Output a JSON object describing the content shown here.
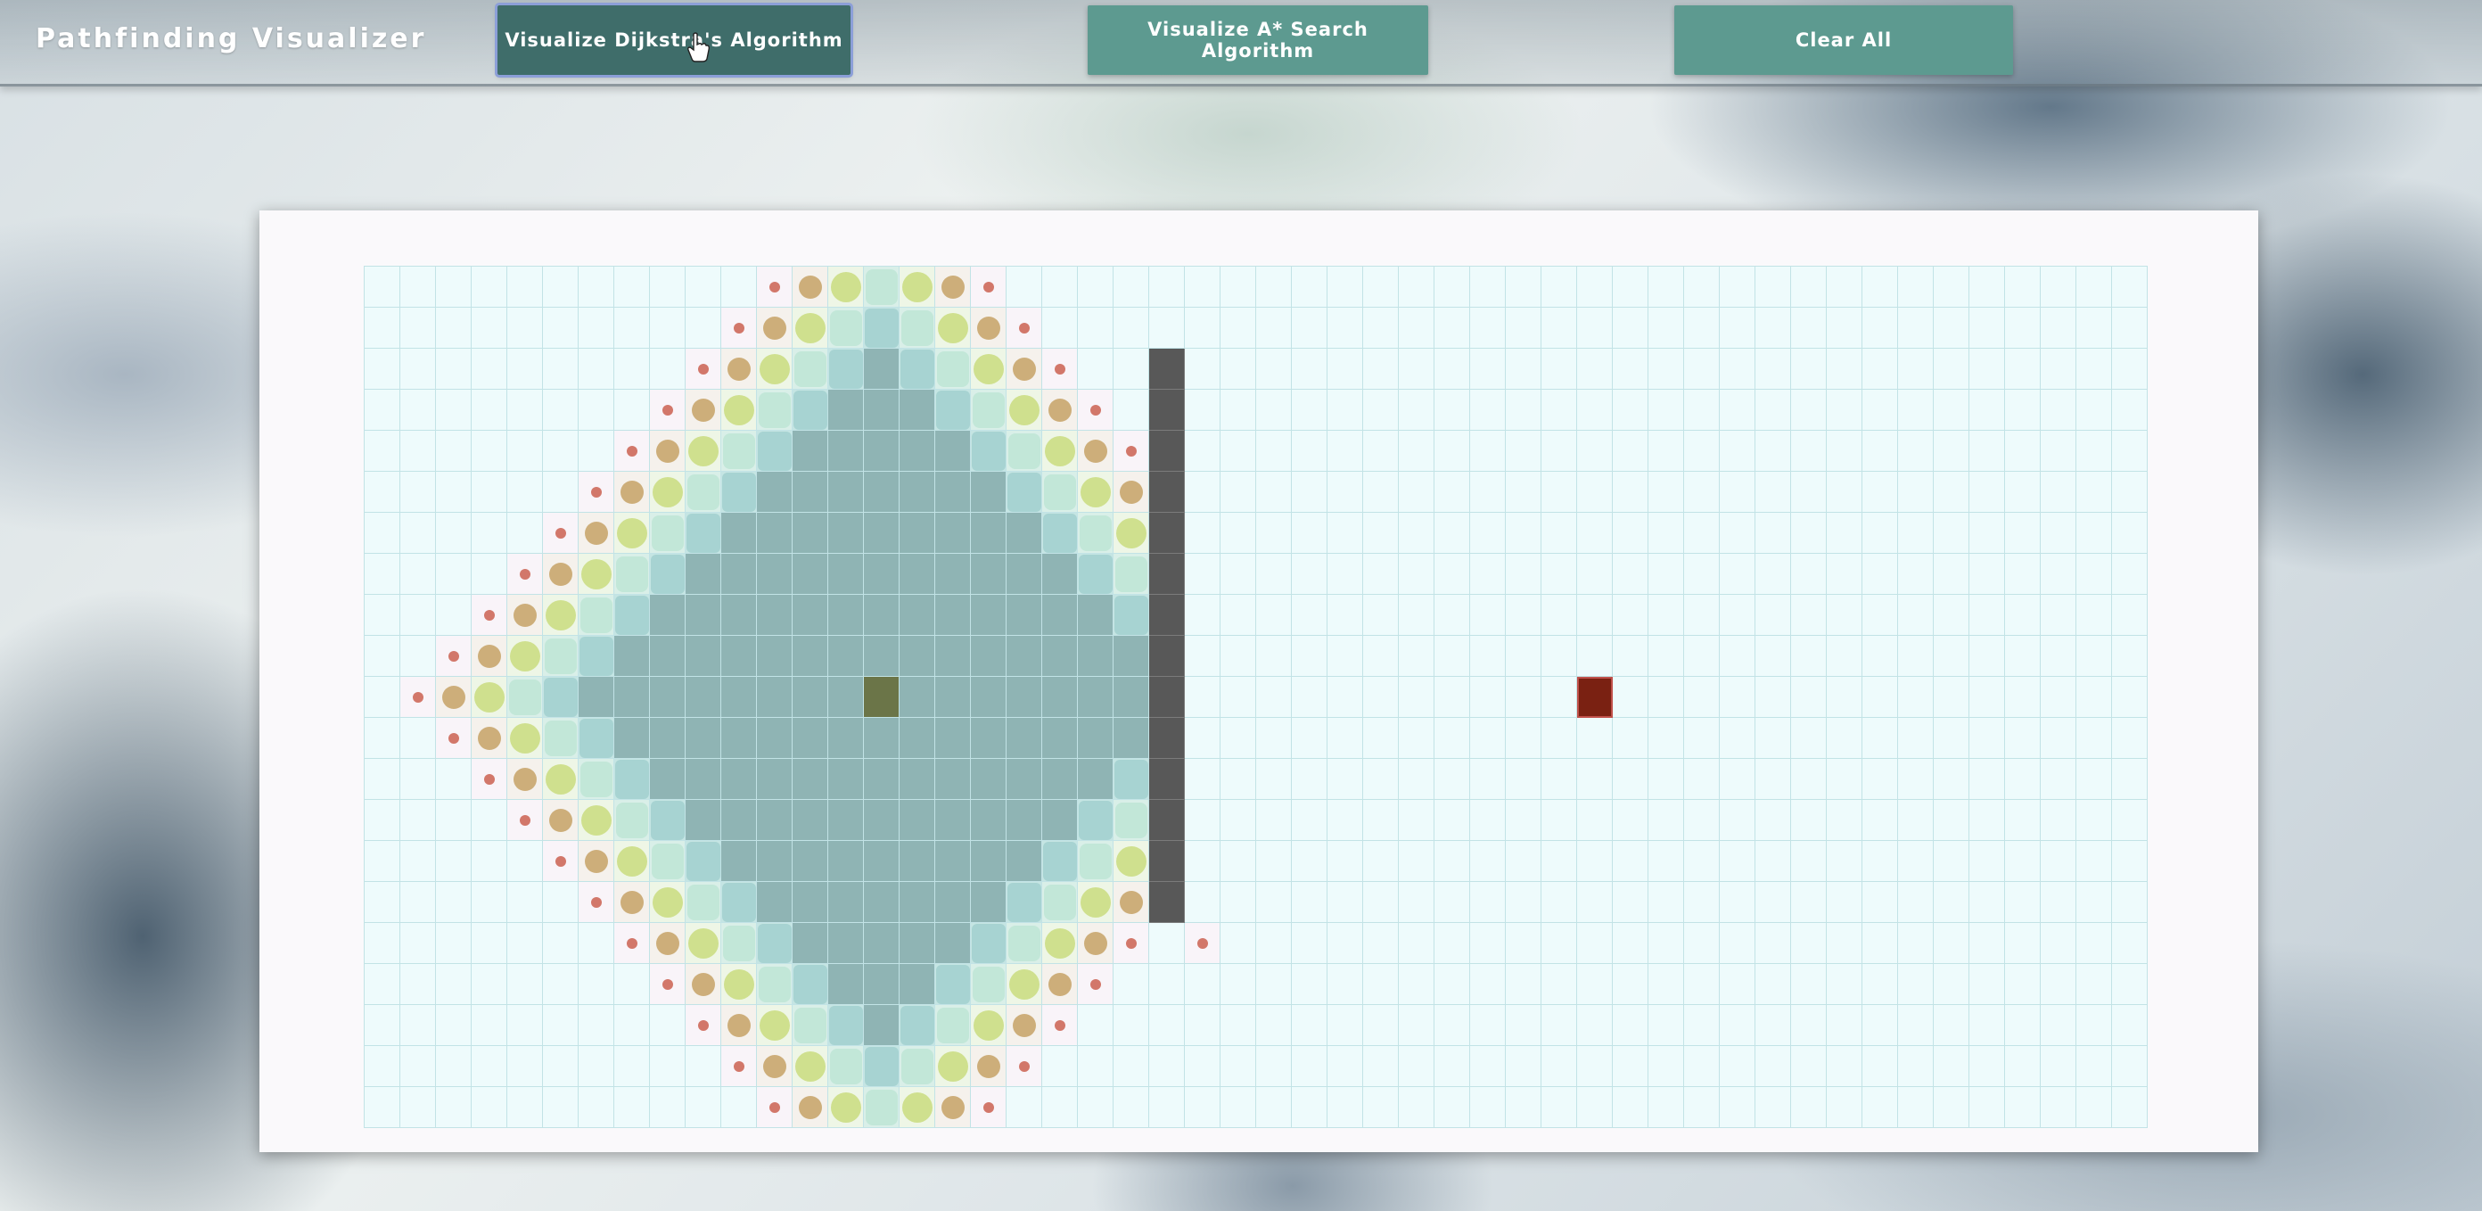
{
  "navbar": {
    "title": "Pathfinding Visualizer",
    "dijkstra_label": "Visualize Dijkstra's Algorithm",
    "astar_label": "Visualize A* Search Algorithm",
    "clear_label": "Clear All"
  },
  "grid": {
    "rows": 21,
    "cols": 50,
    "start": {
      "row": 11,
      "col": 15
    },
    "target": {
      "row": 11,
      "col": 35
    },
    "wall": {
      "col": 23,
      "row_from": 3,
      "row_to": 16
    }
  },
  "colors": {
    "button": "#5d9a90",
    "button_active": "#3f6d6a",
    "cell_unvisited": "#eefbfc",
    "cell_visited": "#8fb4b4",
    "wall": "#585858",
    "start": "#6b7548",
    "target": "#7a2112"
  },
  "icons": {
    "cursor": "hand-pointer-icon"
  }
}
